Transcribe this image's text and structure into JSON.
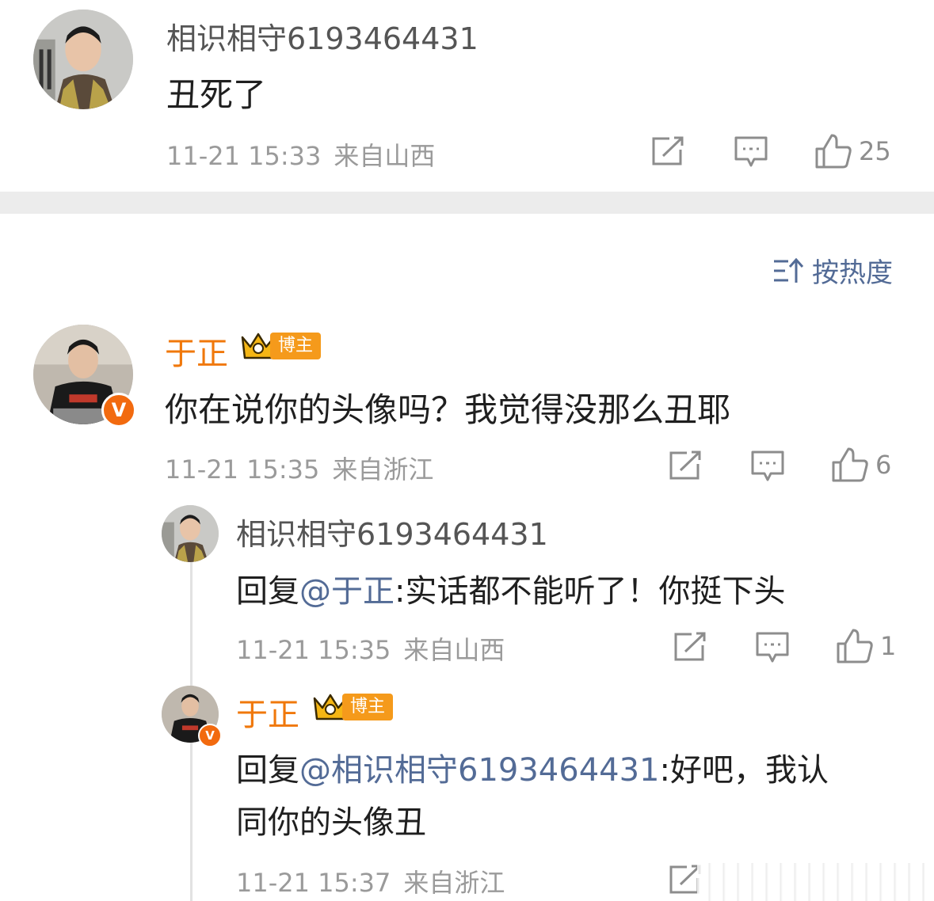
{
  "top_comment": {
    "username": "相识相守6193464431",
    "text": "丑死了",
    "time": "11-21 15:33",
    "location": "来自山西",
    "likes": "25"
  },
  "sort": {
    "label": "按热度"
  },
  "main_comment": {
    "username": "于正",
    "badge": "博主",
    "text": "你在说你的头像吗？我觉得没那么丑耶",
    "time": "11-21 15:35",
    "location": "来自浙江",
    "likes": "6"
  },
  "replies": [
    {
      "username": "相识相守6193464431",
      "prefix": "回复",
      "mention": "@于正",
      "text": ":实话都不能听了！你挺下头",
      "time": "11-21 15:35",
      "location": "来自山西",
      "likes": "1"
    },
    {
      "username": "于正",
      "badge": "博主",
      "prefix": "回复",
      "mention": "@相识相守6193464431",
      "text_line1": ":好吧，我认",
      "text_line2": "同你的头像丑",
      "time": "11-21 15:37",
      "location": "来自浙江"
    }
  ],
  "icons": {
    "share": "share-icon",
    "comment": "comment-icon",
    "like": "thumbs-up-icon",
    "sort": "sort-icon",
    "verified": "verified-v-icon",
    "crown": "crown-icon"
  },
  "colors": {
    "blogger_name": "#f0780b",
    "mention": "#536b96",
    "meta": "#9a9a9a",
    "badge": "#f59a1b"
  }
}
